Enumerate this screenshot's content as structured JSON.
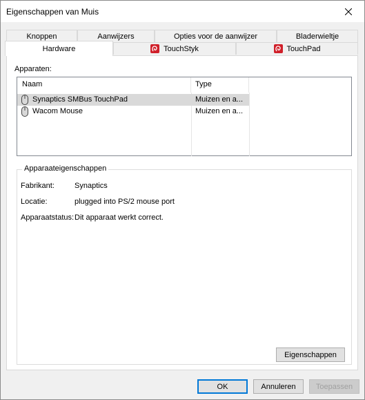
{
  "window": {
    "title": "Eigenschappen van Muis"
  },
  "tabs_row1": [
    {
      "label": "Knoppen"
    },
    {
      "label": "Aanwijzers"
    },
    {
      "label": "Opties voor de aanwijzer"
    },
    {
      "label": "Bladerwieltje"
    }
  ],
  "tabs_row2": [
    {
      "label": "Hardware",
      "active": true
    },
    {
      "label": "TouchStyk",
      "icon": "synaptics-icon"
    },
    {
      "label": "TouchPad",
      "icon": "synaptics-icon"
    }
  ],
  "devices": {
    "label": "Apparaten:",
    "columns": [
      "Naam",
      "Type"
    ],
    "rows": [
      {
        "name": "Synaptics SMBus TouchPad",
        "type": "Muizen en a...",
        "selected": true,
        "icon": "mouse-icon"
      },
      {
        "name": "Wacom Mouse",
        "type": "Muizen en a...",
        "selected": false,
        "icon": "mouse-icon"
      }
    ]
  },
  "properties": {
    "title": "Apparaateigenschappen",
    "fabrikant_label": "Fabrikant:",
    "fabrikant_value": "Synaptics",
    "locatie_label": "Locatie:",
    "locatie_value": "plugged into PS/2 mouse port",
    "status_label": "Apparaatstatus:",
    "status_value": "Dit apparaat werkt correct.",
    "button": "Eigenschappen"
  },
  "footer": {
    "ok": "OK",
    "cancel": "Annuleren",
    "apply": "Toepassen"
  },
  "colors": {
    "accent": "#0078d7",
    "synaptics_red": "#d0202a"
  }
}
